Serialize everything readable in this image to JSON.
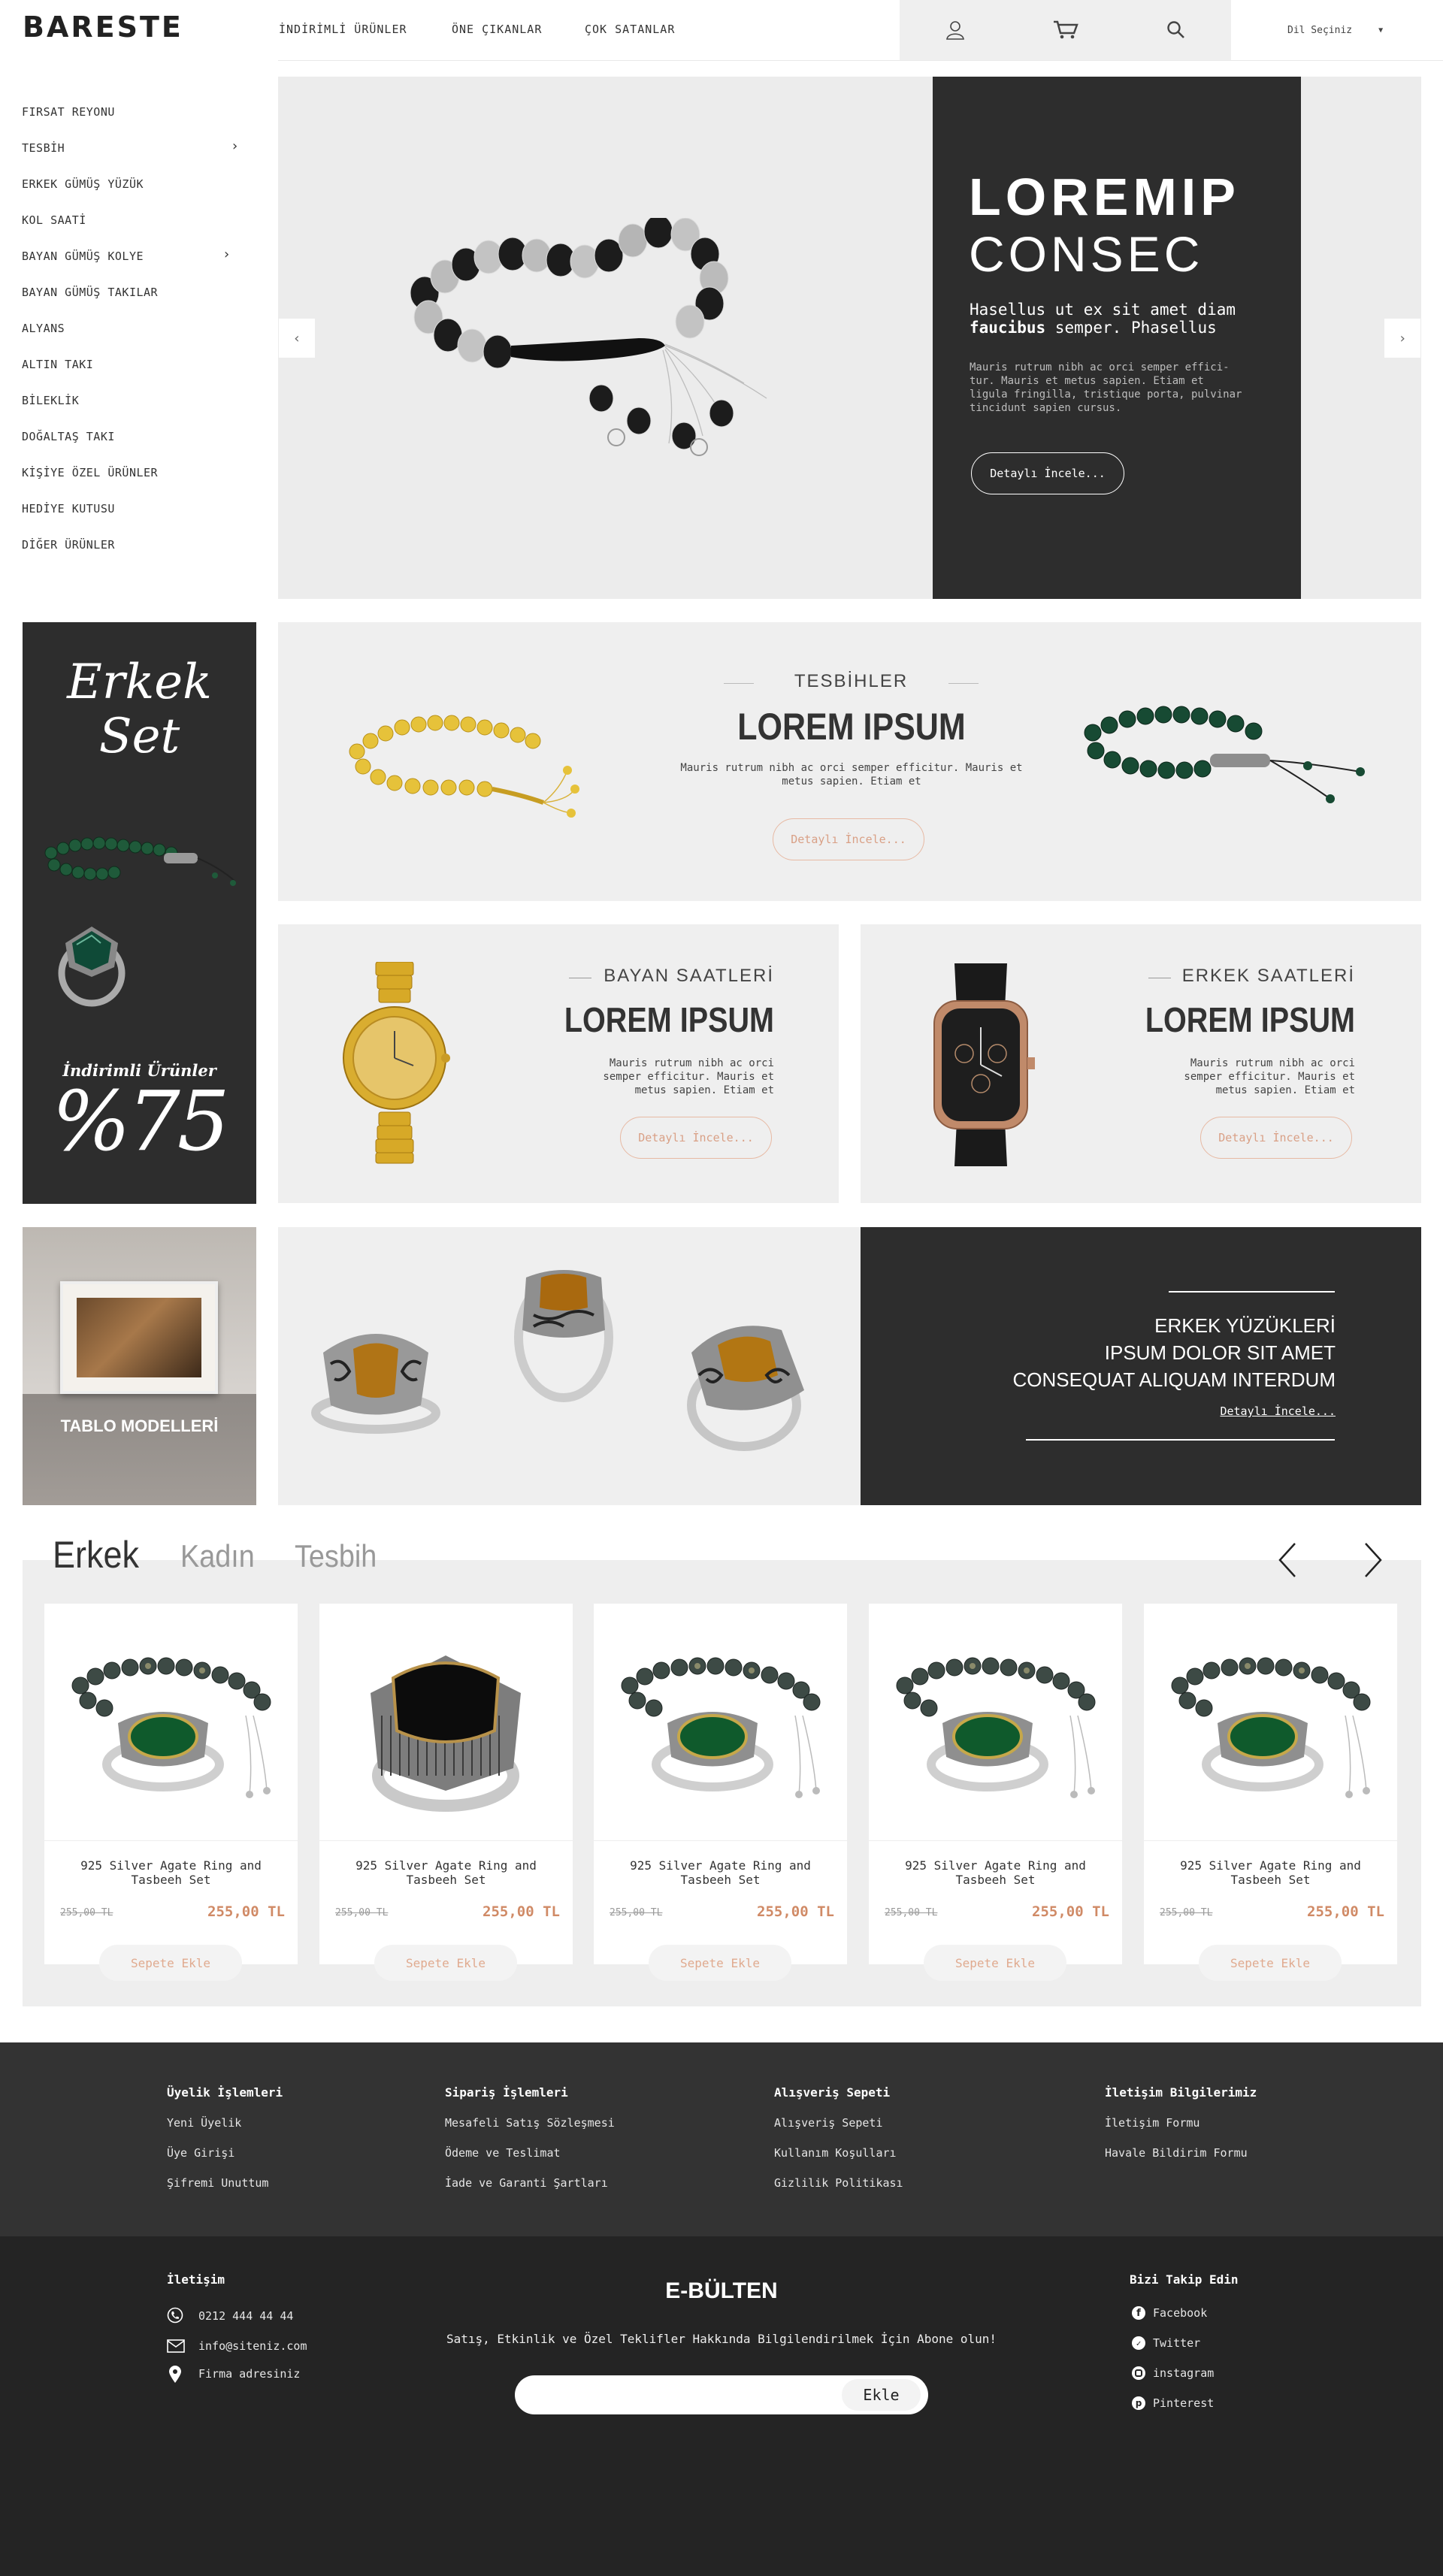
{
  "header": {
    "logo": "BARESTE",
    "nav": [
      "İNDİRİMLİ ÜRÜNLER",
      "ÖNE ÇIKANLAR",
      "ÇOK SATANLAR"
    ],
    "lang": "Dil Seçiniz",
    "icons": [
      "user-icon",
      "cart-icon",
      "search-icon"
    ]
  },
  "sidebar": {
    "items": [
      "FIRSAT REYONU",
      "TESBİH",
      "ERKEK GÜMÜŞ YÜZÜK",
      "KOL SAATİ",
      "BAYAN GÜMÜŞ KOLYE",
      "BAYAN GÜMÜŞ TAKILAR",
      "ALYANS",
      "ALTIN TAKI",
      "BİLEKLİK",
      "DOĞALTAŞ TAKI",
      "KİŞİYE ÖZEL ÜRÜNLER",
      "HEDİYE KUTUSU",
      "DİĞER ÜRÜNLER"
    ]
  },
  "hero": {
    "title1": "LOREMIP",
    "title2": "CONSEC",
    "sub_a": "Hasellus ut ex sit amet diam",
    "sub_b_bold": "faucibus",
    "sub_b_rest": " semper. Phasellus",
    "para_lines": [
      "Mauris rutrum nibh ac orci semper effici-",
      "tur. Mauris et metus sapien. Etiam et",
      "ligula fringilla, tristique porta, pulvinar",
      "tincidunt sapien cursus."
    ],
    "button": "Detaylı İncele...",
    "prev": "‹",
    "next": "›"
  },
  "promo_left": {
    "title1": "Erkek",
    "title2": "Set",
    "label": "İndirimli Ürünler",
    "percent": "%75"
  },
  "tesbih": {
    "kicker": "TESBİHLER",
    "title": "LOREM IPSUM",
    "text_lines": [
      "Mauris rutrum nibh ac orci semper efficitur. Mauris et",
      "metus sapien. Etiam et"
    ],
    "button": "Detaylı İncele..."
  },
  "bayan": {
    "kicker": "BAYAN SAATLERİ",
    "title": "LOREM IPSUM",
    "text_lines": [
      "Mauris rutrum nibh ac orci",
      "semper efficitur. Mauris et",
      "metus sapien. Etiam et"
    ],
    "button": "Detaylı İncele..."
  },
  "erkek_saat": {
    "kicker": "ERKEK SAATLERİ",
    "title": "LOREM IPSUM",
    "text_lines": [
      "Mauris rutrum nibh ac orci",
      "semper efficitur. Mauris et",
      "metus sapien. Etiam et"
    ],
    "button": "Detaylı İncele..."
  },
  "tablo": {
    "label": "TABLO MODELLERİ"
  },
  "rings_banner": {
    "lines": [
      "ERKEK YÜZÜKLERİ",
      "IPSUM DOLOR SIT AMET",
      "CONSEQUAT ALIQUAM INTERDUM"
    ],
    "link": "Detaylı İncele..."
  },
  "tabs": [
    "Erkek",
    "Kadın",
    "Tesbih"
  ],
  "tab_arrows": {
    "prev": "‹",
    "next": "›"
  },
  "products": [
    {
      "name1": "925 Silver Agate Ring and",
      "name2": "Tasbeeh Set",
      "old": "255,00 TL",
      "price": "255,00 TL",
      "button": "Sepete Ekle",
      "image": "ring-tesbih-set"
    },
    {
      "name1": "925 Silver Agate Ring and",
      "name2": "Tasbeeh Set",
      "old": "255,00 TL",
      "price": "255,00 TL",
      "button": "Sepete Ekle",
      "image": "onyx-ring"
    },
    {
      "name1": "925 Silver Agate Ring and",
      "name2": "Tasbeeh Set",
      "old": "255,00 TL",
      "price": "255,00 TL",
      "button": "Sepete Ekle",
      "image": "ring-tesbih-set"
    },
    {
      "name1": "925 Silver Agate Ring and",
      "name2": "Tasbeeh Set",
      "old": "255,00 TL",
      "price": "255,00 TL",
      "button": "Sepete Ekle",
      "image": "ring-tesbih-set"
    },
    {
      "name1": "925 Silver Agate Ring and",
      "name2": "Tasbeeh Set",
      "old": "255,00 TL",
      "price": "255,00 TL",
      "button": "Sepete Ekle",
      "image": "ring-tesbih-set"
    }
  ],
  "footer": {
    "cols": [
      {
        "title": "Üyelik İşlemleri",
        "links": [
          "Yeni Üyelik",
          "Üye Girişi",
          "Şifremi Unuttum"
        ]
      },
      {
        "title": "Sipariş İşlemleri",
        "links": [
          "Mesafeli Satış Sözleşmesi",
          "Ödeme ve Teslimat",
          "İade ve Garanti Şartları"
        ]
      },
      {
        "title": "Alışveriş Sepeti",
        "links": [
          "Alışveriş Sepeti",
          "Kullanım Koşulları",
          "Gizlilik Politikası"
        ]
      },
      {
        "title": "İletişim Bilgilerimiz",
        "links": [
          "İletişim Formu",
          "Havale Bildirim Formu"
        ]
      }
    ],
    "contact": {
      "title": "İletişim",
      "phone": "0212 444 44 44",
      "email": "info@siteniz.com",
      "address": "Firma adresiniz"
    },
    "newsletter": {
      "title": "E-BÜLTEN",
      "text": "Satış, Etkinlik ve Özel Teklifler Hakkında Bilgilendirilmek İçin Abone olun!",
      "placeholder": "",
      "button": "Ekle"
    },
    "social": {
      "title": "Bizi Takip Edin",
      "items": [
        "Facebook",
        "Twitter",
        "instagram",
        "Pinterest"
      ]
    }
  },
  "colors": {
    "dark": "#2d2d2d",
    "panel": "#efefef",
    "accent": "#d08a66",
    "footer_top": "#333333",
    "footer_bottom": "#242424"
  }
}
